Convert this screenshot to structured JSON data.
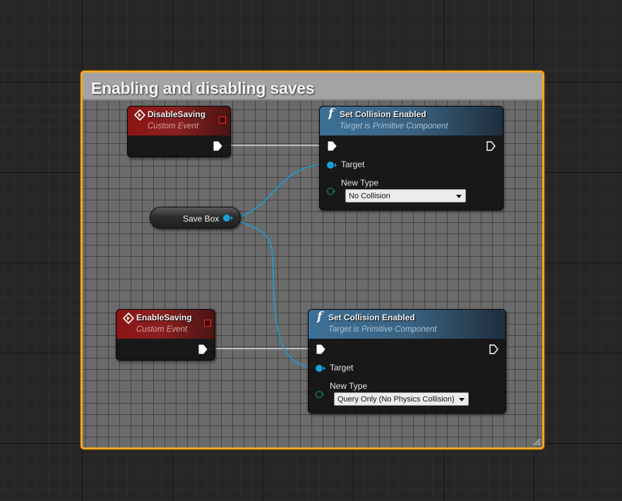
{
  "comment": {
    "title": "Enabling and disabling saves",
    "color": "#f3a81d"
  },
  "events": [
    {
      "title": "DisableSaving",
      "subtitle": "Custom Event"
    },
    {
      "title": "EnableSaving",
      "subtitle": "Custom Event"
    }
  ],
  "functions": [
    {
      "title": "Set Collision Enabled",
      "subtitle": "Target is Primitive Component",
      "target_label": "Target",
      "new_type_label": "New Type",
      "new_type_value": "No Collision"
    },
    {
      "title": "Set Collision Enabled",
      "subtitle": "Target is Primitive Component",
      "target_label": "Target",
      "new_type_label": "New Type",
      "new_type_value": "Query Only (No Physics Collision)"
    }
  ],
  "variable": {
    "name": "Save Box"
  },
  "icons": {
    "event": "custom-event-icon",
    "function": "function-icon",
    "exec_pin": "exec-pin-icon",
    "object_pin": "object-pin-icon",
    "delegate_pin": "delegate-pin-icon"
  },
  "colors": {
    "exec_wire": "#d8d8d8",
    "object_wire": "#1b9ed8",
    "event_header": "#8c1414",
    "function_header": "#3d6f96",
    "enum_pin": "#0c5a4c"
  }
}
